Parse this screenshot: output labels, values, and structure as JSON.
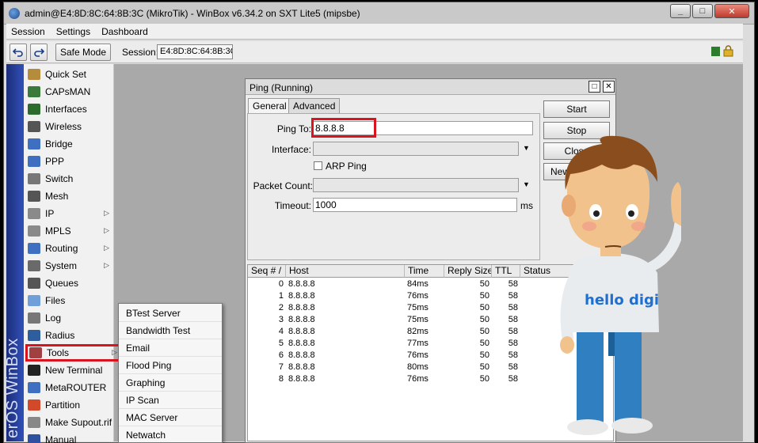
{
  "window": {
    "title": "admin@E4:8D:8C:64:8B:3C (MikroTik) - WinBox v6.34.2 on SXT Lite5 (mipsbe)",
    "buttons": [
      "_",
      "□",
      "✕"
    ]
  },
  "menubar": [
    "Session",
    "Settings",
    "Dashboard"
  ],
  "toolbar": {
    "undo_icon": "undo-icon",
    "redo_icon": "redo-icon",
    "safe_mode": "Safe Mode",
    "session_label": "Session:",
    "session_value": "E4:8D:8C:64:8B:3C"
  },
  "sidebar": {
    "brand": "erOS WinBox",
    "items": [
      {
        "label": "Quick Set",
        "icon": "wand-icon",
        "color": "#b58c3c"
      },
      {
        "label": "CAPsMAN",
        "icon": "capsman-icon",
        "color": "#3a7a3a"
      },
      {
        "label": "Interfaces",
        "icon": "interfaces-icon",
        "color": "#2d6a2d"
      },
      {
        "label": "Wireless",
        "icon": "wireless-icon",
        "color": "#555555"
      },
      {
        "label": "Bridge",
        "icon": "bridge-icon",
        "color": "#3f6fc0"
      },
      {
        "label": "PPP",
        "icon": "ppp-icon",
        "color": "#3f6fc0"
      },
      {
        "label": "Switch",
        "icon": "switch-icon",
        "color": "#777777"
      },
      {
        "label": "Mesh",
        "icon": "mesh-icon",
        "color": "#555555"
      },
      {
        "label": "IP",
        "icon": "ip-icon",
        "color": "#8a8a8a",
        "submenu": true
      },
      {
        "label": "MPLS",
        "icon": "mpls-icon",
        "color": "#8a8a8a",
        "submenu": true
      },
      {
        "label": "Routing",
        "icon": "routing-icon",
        "color": "#3f6fc0",
        "submenu": true
      },
      {
        "label": "System",
        "icon": "system-icon",
        "color": "#6a6a6a",
        "submenu": true
      },
      {
        "label": "Queues",
        "icon": "queues-icon",
        "color": "#555555"
      },
      {
        "label": "Files",
        "icon": "files-icon",
        "color": "#6f9ed8"
      },
      {
        "label": "Log",
        "icon": "log-icon",
        "color": "#777777"
      },
      {
        "label": "Radius",
        "icon": "radius-icon",
        "color": "#2e5e9e"
      },
      {
        "label": "Tools",
        "icon": "tools-icon",
        "color": "#a04040",
        "submenu": true
      },
      {
        "label": "New Terminal",
        "icon": "terminal-icon",
        "color": "#222222"
      },
      {
        "label": "MetaROUTER",
        "icon": "metarouter-icon",
        "color": "#3f6fc0"
      },
      {
        "label": "Partition",
        "icon": "partition-icon",
        "color": "#d24a2a"
      },
      {
        "label": "Make Supout.rif",
        "icon": "supout-icon",
        "color": "#888888"
      },
      {
        "label": "Manual",
        "icon": "manual-icon",
        "color": "#3050a0"
      }
    ]
  },
  "tools_submenu": [
    "BTest Server",
    "Bandwidth Test",
    "Email",
    "Flood Ping",
    "Graphing",
    "IP Scan",
    "MAC Server",
    "Netwatch"
  ],
  "ping": {
    "title": "Ping (Running)",
    "tabs": [
      "General",
      "Advanced"
    ],
    "ping_to_label": "Ping To:",
    "ping_to_value": "8.8.8.8",
    "interface_label": "Interface:",
    "arp_ping_label": "ARP Ping",
    "packet_count_label": "Packet Count:",
    "timeout_label": "Timeout:",
    "timeout_value": "1000",
    "timeout_unit": "ms",
    "buttons": [
      "Start",
      "Stop",
      "Close",
      "New"
    ],
    "columns": [
      "Seq # /",
      "Host",
      "Time",
      "Reply Size",
      "TTL",
      "Status"
    ],
    "rows": [
      {
        "seq": "0",
        "host": "8.8.8.8",
        "time": "84ms",
        "size": "50",
        "ttl": "58"
      },
      {
        "seq": "1",
        "host": "8.8.8.8",
        "time": "76ms",
        "size": "50",
        "ttl": "58"
      },
      {
        "seq": "2",
        "host": "8.8.8.8",
        "time": "75ms",
        "size": "50",
        "ttl": "58"
      },
      {
        "seq": "3",
        "host": "8.8.8.8",
        "time": "75ms",
        "size": "50",
        "ttl": "58"
      },
      {
        "seq": "4",
        "host": "8.8.8.8",
        "time": "82ms",
        "size": "50",
        "ttl": "58"
      },
      {
        "seq": "5",
        "host": "8.8.8.8",
        "time": "77ms",
        "size": "50",
        "ttl": "58"
      },
      {
        "seq": "6",
        "host": "8.8.8.8",
        "time": "76ms",
        "size": "50",
        "ttl": "58"
      },
      {
        "seq": "7",
        "host": "8.8.8.8",
        "time": "80ms",
        "size": "50",
        "ttl": "58"
      },
      {
        "seq": "8",
        "host": "8.8.8.8",
        "time": "76ms",
        "size": "50",
        "ttl": "58"
      }
    ]
  },
  "mascot": {
    "shirt_text": "hello digi"
  },
  "colors": {
    "highlight": "#d8141e",
    "brand_bar": "#2a44a8",
    "shirt_text": "#1f6fd0"
  }
}
